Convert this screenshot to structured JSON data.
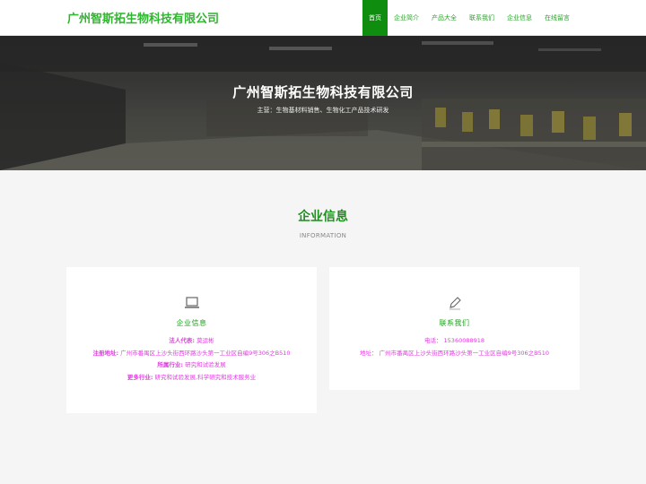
{
  "header": {
    "logo": "广州智斯拓生物科技有限公司",
    "nav": [
      "首页",
      "企业简介",
      "产品大全",
      "联系我们",
      "企业信息",
      "在线留言"
    ],
    "active_index": 0,
    "colors": {
      "logo": "#2fb62f",
      "nav_active_bg": "#0f8d0f",
      "nav_text": "#2ea12e"
    }
  },
  "hero": {
    "title": "广州智斯拓生物科技有限公司",
    "subtitle": "主营：生物基材料销售、生物化工产品技术研发"
  },
  "section": {
    "title": "企业信息",
    "subtitle": "INFORMATION"
  },
  "company_card": {
    "icon": "laptop-icon",
    "title": "企业信息",
    "rows": [
      {
        "label": "法人代表:",
        "value": "莫运彬"
      },
      {
        "label": "注册地址:",
        "value": "广州市番禺区上沙头街西环路沙头第一工业区自编9号306之B510"
      },
      {
        "label": "所属行业:",
        "value": "研究和试验发展"
      },
      {
        "label": "更多行业:",
        "value": "研究和试验发展,科学研究和技术服务业"
      }
    ]
  },
  "contact_card": {
    "icon": "pencil-icon",
    "title": "联系我们",
    "rows": [
      {
        "label": "电话：",
        "value": "15360088918"
      },
      {
        "label": "地址：",
        "value": "广州市番禺区上沙头街西环路沙头第一工业区自编9号306之B510"
      }
    ]
  },
  "colors": {
    "accent": "#1e8e1e",
    "info_text": "#e33ce3"
  }
}
